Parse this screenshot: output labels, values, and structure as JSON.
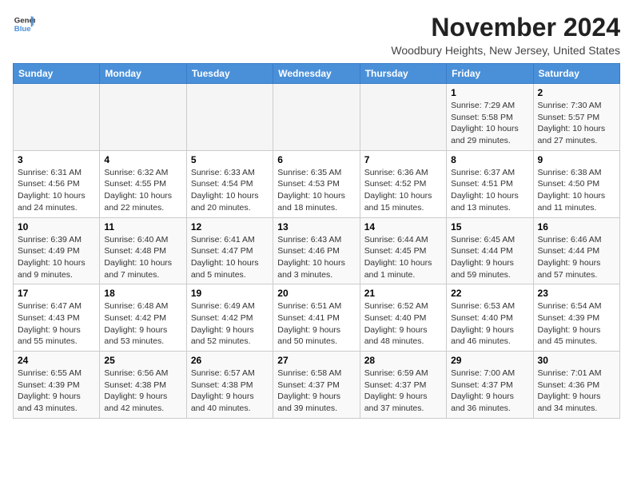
{
  "header": {
    "logo_general": "General",
    "logo_blue": "Blue",
    "title": "November 2024",
    "subtitle": "Woodbury Heights, New Jersey, United States"
  },
  "calendar": {
    "weekdays": [
      "Sunday",
      "Monday",
      "Tuesday",
      "Wednesday",
      "Thursday",
      "Friday",
      "Saturday"
    ],
    "weeks": [
      [
        {
          "day": "",
          "info": ""
        },
        {
          "day": "",
          "info": ""
        },
        {
          "day": "",
          "info": ""
        },
        {
          "day": "",
          "info": ""
        },
        {
          "day": "",
          "info": ""
        },
        {
          "day": "1",
          "info": "Sunrise: 7:29 AM\nSunset: 5:58 PM\nDaylight: 10 hours and 29 minutes."
        },
        {
          "day": "2",
          "info": "Sunrise: 7:30 AM\nSunset: 5:57 PM\nDaylight: 10 hours and 27 minutes."
        }
      ],
      [
        {
          "day": "3",
          "info": "Sunrise: 6:31 AM\nSunset: 4:56 PM\nDaylight: 10 hours and 24 minutes."
        },
        {
          "day": "4",
          "info": "Sunrise: 6:32 AM\nSunset: 4:55 PM\nDaylight: 10 hours and 22 minutes."
        },
        {
          "day": "5",
          "info": "Sunrise: 6:33 AM\nSunset: 4:54 PM\nDaylight: 10 hours and 20 minutes."
        },
        {
          "day": "6",
          "info": "Sunrise: 6:35 AM\nSunset: 4:53 PM\nDaylight: 10 hours and 18 minutes."
        },
        {
          "day": "7",
          "info": "Sunrise: 6:36 AM\nSunset: 4:52 PM\nDaylight: 10 hours and 15 minutes."
        },
        {
          "day": "8",
          "info": "Sunrise: 6:37 AM\nSunset: 4:51 PM\nDaylight: 10 hours and 13 minutes."
        },
        {
          "day": "9",
          "info": "Sunrise: 6:38 AM\nSunset: 4:50 PM\nDaylight: 10 hours and 11 minutes."
        }
      ],
      [
        {
          "day": "10",
          "info": "Sunrise: 6:39 AM\nSunset: 4:49 PM\nDaylight: 10 hours and 9 minutes."
        },
        {
          "day": "11",
          "info": "Sunrise: 6:40 AM\nSunset: 4:48 PM\nDaylight: 10 hours and 7 minutes."
        },
        {
          "day": "12",
          "info": "Sunrise: 6:41 AM\nSunset: 4:47 PM\nDaylight: 10 hours and 5 minutes."
        },
        {
          "day": "13",
          "info": "Sunrise: 6:43 AM\nSunset: 4:46 PM\nDaylight: 10 hours and 3 minutes."
        },
        {
          "day": "14",
          "info": "Sunrise: 6:44 AM\nSunset: 4:45 PM\nDaylight: 10 hours and 1 minute."
        },
        {
          "day": "15",
          "info": "Sunrise: 6:45 AM\nSunset: 4:44 PM\nDaylight: 9 hours and 59 minutes."
        },
        {
          "day": "16",
          "info": "Sunrise: 6:46 AM\nSunset: 4:44 PM\nDaylight: 9 hours and 57 minutes."
        }
      ],
      [
        {
          "day": "17",
          "info": "Sunrise: 6:47 AM\nSunset: 4:43 PM\nDaylight: 9 hours and 55 minutes."
        },
        {
          "day": "18",
          "info": "Sunrise: 6:48 AM\nSunset: 4:42 PM\nDaylight: 9 hours and 53 minutes."
        },
        {
          "day": "19",
          "info": "Sunrise: 6:49 AM\nSunset: 4:42 PM\nDaylight: 9 hours and 52 minutes."
        },
        {
          "day": "20",
          "info": "Sunrise: 6:51 AM\nSunset: 4:41 PM\nDaylight: 9 hours and 50 minutes."
        },
        {
          "day": "21",
          "info": "Sunrise: 6:52 AM\nSunset: 4:40 PM\nDaylight: 9 hours and 48 minutes."
        },
        {
          "day": "22",
          "info": "Sunrise: 6:53 AM\nSunset: 4:40 PM\nDaylight: 9 hours and 46 minutes."
        },
        {
          "day": "23",
          "info": "Sunrise: 6:54 AM\nSunset: 4:39 PM\nDaylight: 9 hours and 45 minutes."
        }
      ],
      [
        {
          "day": "24",
          "info": "Sunrise: 6:55 AM\nSunset: 4:39 PM\nDaylight: 9 hours and 43 minutes."
        },
        {
          "day": "25",
          "info": "Sunrise: 6:56 AM\nSunset: 4:38 PM\nDaylight: 9 hours and 42 minutes."
        },
        {
          "day": "26",
          "info": "Sunrise: 6:57 AM\nSunset: 4:38 PM\nDaylight: 9 hours and 40 minutes."
        },
        {
          "day": "27",
          "info": "Sunrise: 6:58 AM\nSunset: 4:37 PM\nDaylight: 9 hours and 39 minutes."
        },
        {
          "day": "28",
          "info": "Sunrise: 6:59 AM\nSunset: 4:37 PM\nDaylight: 9 hours and 37 minutes."
        },
        {
          "day": "29",
          "info": "Sunrise: 7:00 AM\nSunset: 4:37 PM\nDaylight: 9 hours and 36 minutes."
        },
        {
          "day": "30",
          "info": "Sunrise: 7:01 AM\nSunset: 4:36 PM\nDaylight: 9 hours and 34 minutes."
        }
      ]
    ]
  }
}
